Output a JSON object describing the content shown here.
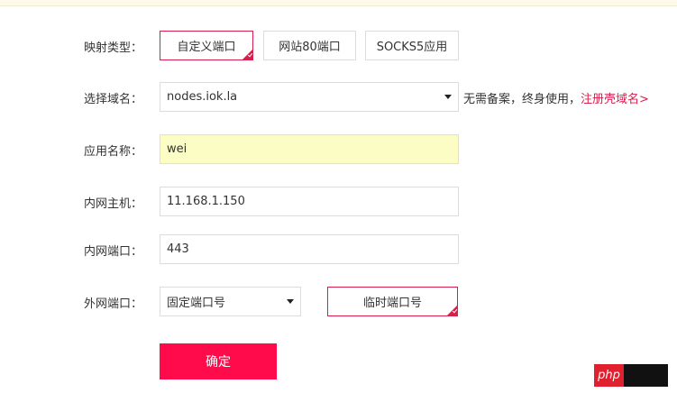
{
  "form": {
    "mapping_type": {
      "label": "映射类型：",
      "options": [
        "自定义端口",
        "网站80端口",
        "SOCKS5应用"
      ],
      "selected": "自定义端口"
    },
    "domain": {
      "label": "选择域名：",
      "value": "nodes.iok.la",
      "note": "无需备案，终身使用，",
      "link": "注册壳域名>"
    },
    "app_name": {
      "label": "应用名称：",
      "value": "wei"
    },
    "internal_host": {
      "label": "内网主机：",
      "value": "11.168.1.150"
    },
    "internal_port": {
      "label": "内网端口：",
      "value": "443"
    },
    "external_port": {
      "label": "外网端口：",
      "select_value": "固定端口号",
      "temp_button": "临时端口号"
    },
    "submit_label": "确定"
  },
  "watermark": {
    "text": "php"
  },
  "colors": {
    "accent": "#d81e4a",
    "submit": "#ff0a4a",
    "highlight_field": "#fbfdc5"
  }
}
